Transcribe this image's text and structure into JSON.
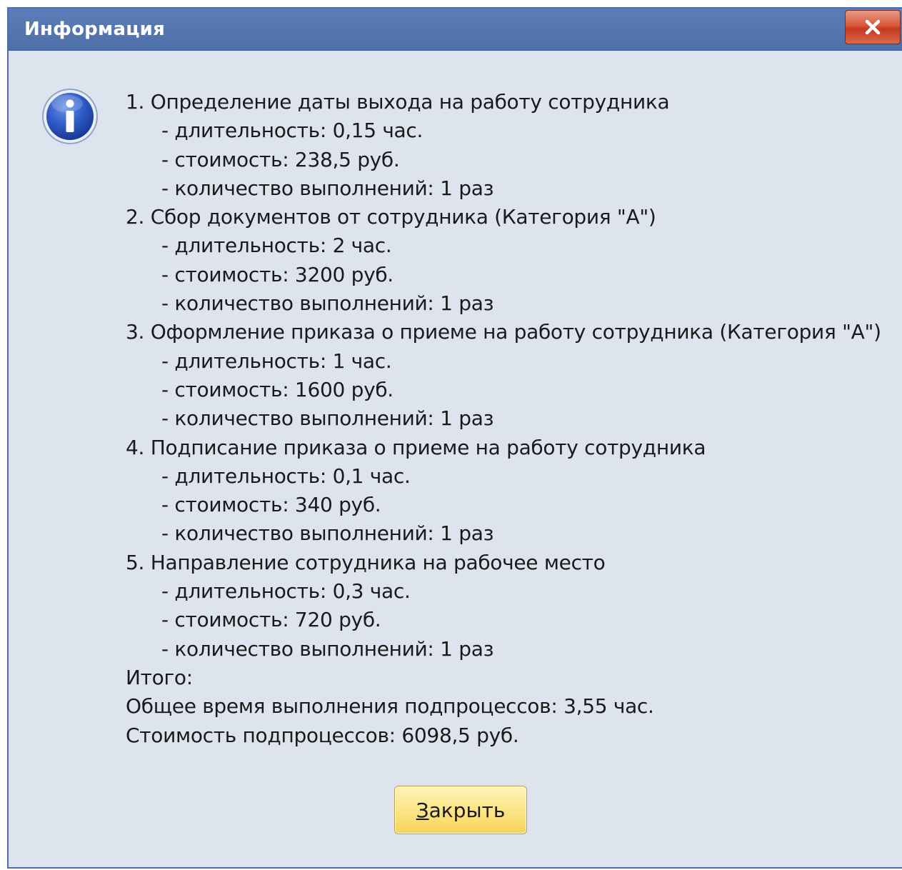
{
  "window": {
    "title": "Информация",
    "close_glyph": "x"
  },
  "icon": "info-icon",
  "lines": [
    {
      "text": "1. Определение даты выхода на работу сотрудника",
      "indent": false
    },
    {
      "text": "- длительность: 0,15 час.",
      "indent": true
    },
    {
      "text": "- стоимость: 238,5 руб.",
      "indent": true
    },
    {
      "text": "- количество выполнений: 1 раз",
      "indent": true
    },
    {
      "text": "2. Сбор документов от сотрудника (Категория \"А\")",
      "indent": false
    },
    {
      "text": "- длительность: 2 час.",
      "indent": true
    },
    {
      "text": "- стоимость: 3200 руб.",
      "indent": true
    },
    {
      "text": "- количество выполнений: 1 раз",
      "indent": true
    },
    {
      "text": "3. Оформление приказа о приеме на работу сотрудника (Категория \"А\")",
      "indent": false
    },
    {
      "text": "- длительность: 1 час.",
      "indent": true
    },
    {
      "text": "- стоимость: 1600 руб.",
      "indent": true
    },
    {
      "text": "- количество выполнений: 1 раз",
      "indent": true
    },
    {
      "text": "4. Подписание приказа о приеме на работу сотрудника",
      "indent": false
    },
    {
      "text": "- длительность: 0,1 час.",
      "indent": true
    },
    {
      "text": "- стоимость: 340 руб.",
      "indent": true
    },
    {
      "text": "- количество выполнений: 1 раз",
      "indent": true
    },
    {
      "text": "5. Направление сотрудника на рабочее место",
      "indent": false
    },
    {
      "text": "- длительность: 0,3 час.",
      "indent": true
    },
    {
      "text": "- стоимость: 720 руб.",
      "indent": true
    },
    {
      "text": "- количество выполнений: 1 раз",
      "indent": true
    },
    {
      "text": "Итого:",
      "indent": false
    },
    {
      "text": "Общее время выполнения подпроцессов: 3,55 час.",
      "indent": false
    },
    {
      "text": "Стоимость подпроцессов: 6098,5 руб.",
      "indent": false
    }
  ],
  "button": {
    "mnemonic": "З",
    "rest": "акрыть"
  },
  "colors": {
    "titlebar": "#5573ad",
    "background": "#dde4ee",
    "close_button": "#d0492c",
    "action_button": "#fbe07a"
  }
}
